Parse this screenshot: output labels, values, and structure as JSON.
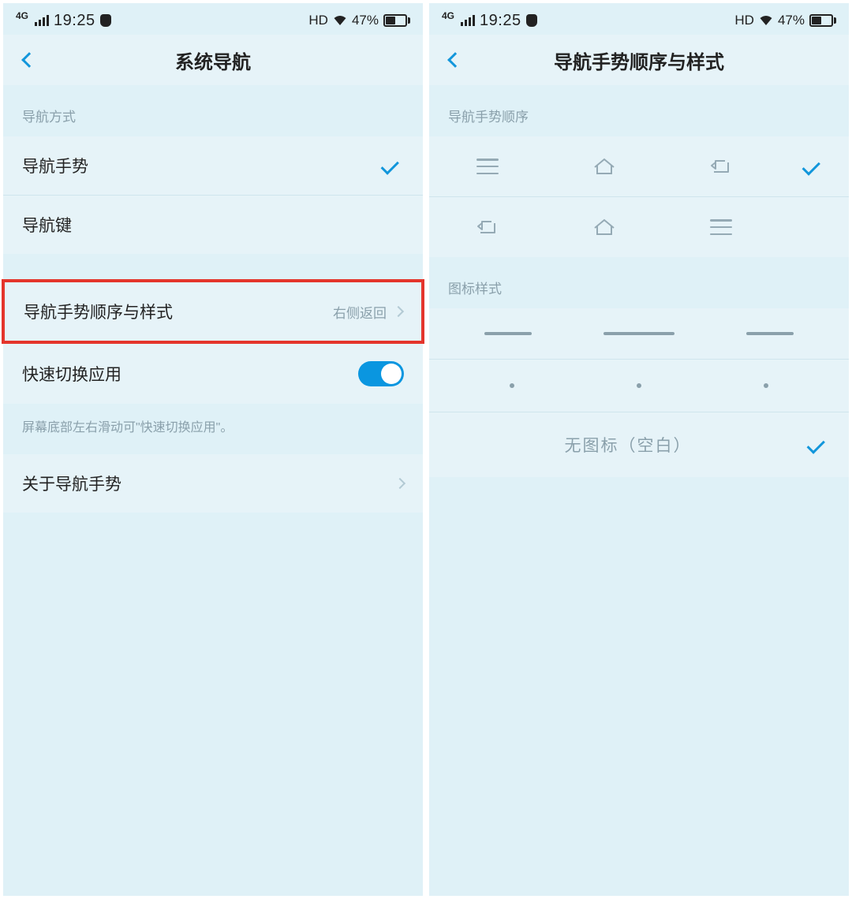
{
  "status": {
    "net_label": "4G",
    "time": "19:25",
    "hd": "HD",
    "battery_pct": "47%"
  },
  "left": {
    "title": "系统导航",
    "section_nav_mode": "导航方式",
    "item_gesture": "导航手势",
    "item_keys": "导航键",
    "item_order": "导航手势顺序与样式",
    "item_order_value": "右侧返回",
    "item_quick_switch": "快速切换应用",
    "hint": "屏幕底部左右滑动可\"快速切换应用\"。",
    "item_about": "关于导航手势"
  },
  "right": {
    "title": "导航手势顺序与样式",
    "section_order": "导航手势顺序",
    "section_style": "图标样式",
    "blank_label": "无图标（空白）"
  }
}
